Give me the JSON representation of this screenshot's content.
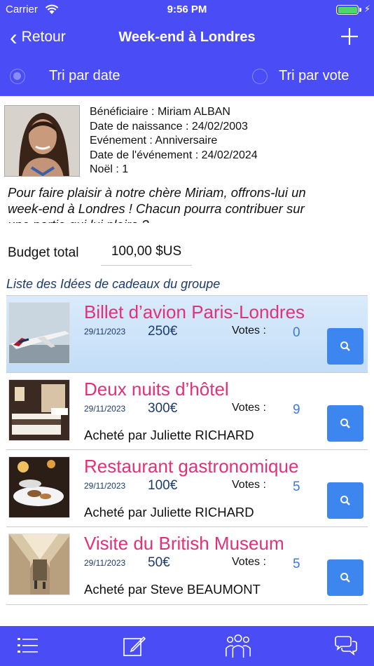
{
  "status_bar": {
    "carrier": "Carrier",
    "time": "9:56 PM"
  },
  "nav": {
    "back_label": "Retour",
    "title": "Week-end à Londres",
    "add_icon": "plus-icon"
  },
  "sort": {
    "by_date_label": "Tri par date",
    "by_vote_label": "Tri par vote",
    "selected": "date"
  },
  "beneficiary": {
    "line1": "Bénéficiaire : Miriam ALBAN",
    "line2": "Date de naissance : 24/02/2003",
    "line3": "Evénement : Anniversaire",
    "line4": "Date de l'événement : 24/02/2024",
    "line5": "Noël : 1",
    "description": "Pour faire plaisir à notre chère Miriam, offrons-lui un week-end à Londres ! Chacun pourra contribuer sur une partie qui lui plaira ?"
  },
  "budget": {
    "label": "Budget total",
    "value": "100,00 $US"
  },
  "gifts_title": "Liste des Idées de cadeaux du groupe",
  "gifts": [
    {
      "name": "Billet d’avion Paris-Londres",
      "date": "29/11/2023",
      "price": "250€",
      "votes_label": "Votes :",
      "votes": "0",
      "buyer": "",
      "image": "airplane-photo"
    },
    {
      "name": "Deux nuits d’hôtel",
      "date": "29/11/2023",
      "price": "300€",
      "votes_label": "Votes :",
      "votes": "9",
      "buyer": "Acheté par Juliette RICHARD",
      "image": "hotel-room-photo"
    },
    {
      "name": "Restaurant gastronomique",
      "date": "29/11/2023",
      "price": "100€",
      "votes_label": "Votes :",
      "votes": "5",
      "buyer": "Acheté par Juliette RICHARD",
      "image": "restaurant-photo"
    },
    {
      "name": "Visite du British Museum",
      "date": "29/11/2023",
      "price": "50€",
      "votes_label": "Votes :",
      "votes": "5",
      "buyer": "Acheté par Steve BEAUMONT",
      "image": "museum-photo"
    }
  ],
  "tabbar": {
    "icons": [
      "list-icon",
      "edit-icon",
      "group-icon",
      "chat-icon"
    ]
  },
  "colors": {
    "primary": "#4a4df5",
    "gift_name": "#e0317a",
    "price": "#1d3a6e",
    "votes": "#3a7bd5",
    "search_button": "#3d86f0",
    "selected_row": "#cfe4f9"
  }
}
